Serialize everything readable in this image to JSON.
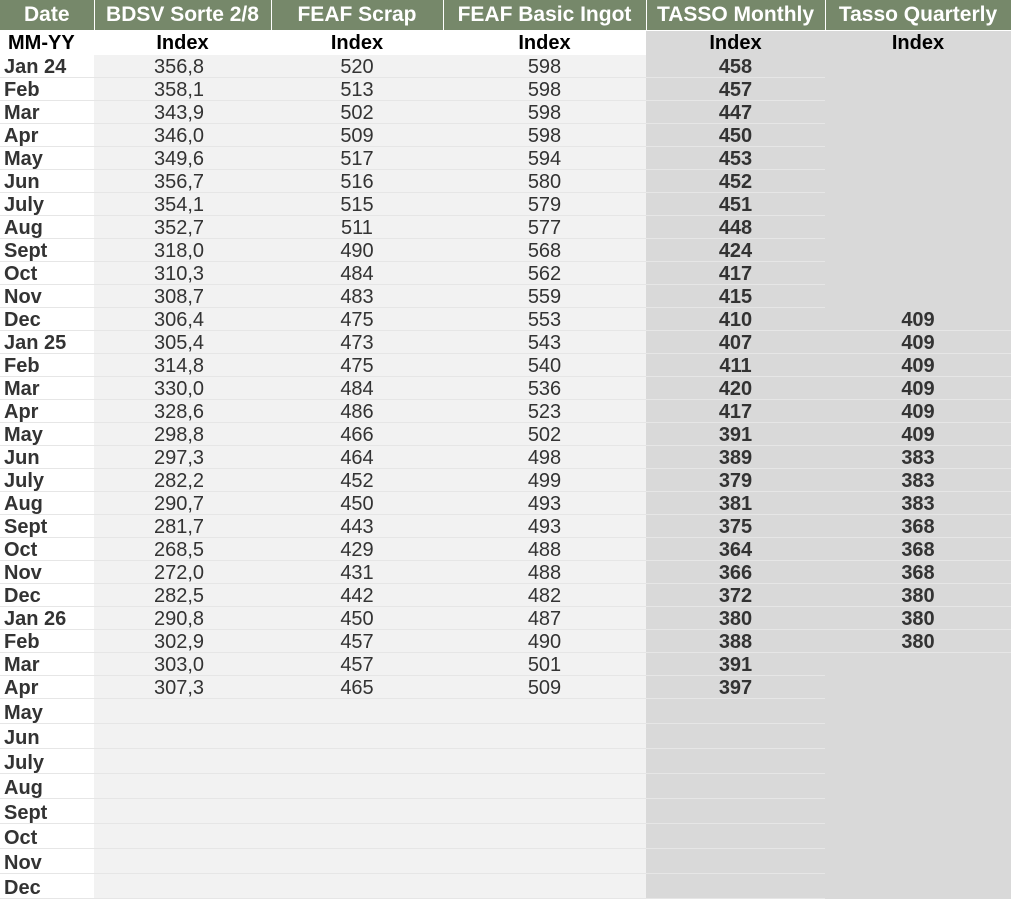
{
  "headers": {
    "date": "Date",
    "bdsv": "BDSV Sorte 2/8",
    "scrap": "FEAF Scrap",
    "ingot": "FEAF Basic Ingot",
    "monthly": "TASSO Monthly",
    "quarterly": "Tasso Quarterly"
  },
  "subheaders": {
    "date": "MM-YY",
    "bdsv": "Index",
    "scrap": "Index",
    "ingot": "Index",
    "monthly": "Index",
    "quarterly": "Index"
  },
  "rows": [
    {
      "date": "Jan 24",
      "bdsv": "356,8",
      "scrap": "520",
      "ingot": "598",
      "monthly": "458",
      "quarterly": ""
    },
    {
      "date": "Feb",
      "bdsv": "358,1",
      "scrap": "513",
      "ingot": "598",
      "monthly": "457",
      "quarterly": ""
    },
    {
      "date": "Mar",
      "bdsv": "343,9",
      "scrap": "502",
      "ingot": "598",
      "monthly": "447",
      "quarterly": ""
    },
    {
      "date": "Apr",
      "bdsv": "346,0",
      "scrap": "509",
      "ingot": "598",
      "monthly": "450",
      "quarterly": ""
    },
    {
      "date": "May",
      "bdsv": "349,6",
      "scrap": "517",
      "ingot": "594",
      "monthly": "453",
      "quarterly": ""
    },
    {
      "date": "Jun",
      "bdsv": "356,7",
      "scrap": "516",
      "ingot": "580",
      "monthly": "452",
      "quarterly": ""
    },
    {
      "date": "July",
      "bdsv": "354,1",
      "scrap": "515",
      "ingot": "579",
      "monthly": "451",
      "quarterly": ""
    },
    {
      "date": "Aug",
      "bdsv": "352,7",
      "scrap": "511",
      "ingot": "577",
      "monthly": "448",
      "quarterly": ""
    },
    {
      "date": "Sept",
      "bdsv": "318,0",
      "scrap": "490",
      "ingot": "568",
      "monthly": "424",
      "quarterly": ""
    },
    {
      "date": "Oct",
      "bdsv": "310,3",
      "scrap": "484",
      "ingot": "562",
      "monthly": "417",
      "quarterly": ""
    },
    {
      "date": "Nov",
      "bdsv": "308,7",
      "scrap": "483",
      "ingot": "559",
      "monthly": "415",
      "quarterly": ""
    },
    {
      "date": "Dec",
      "bdsv": "306,4",
      "scrap": "475",
      "ingot": "553",
      "monthly": "410",
      "quarterly": "409"
    },
    {
      "date": "Jan 25",
      "bdsv": "305,4",
      "scrap": "473",
      "ingot": "543",
      "monthly": "407",
      "quarterly": "409"
    },
    {
      "date": "Feb",
      "bdsv": "314,8",
      "scrap": "475",
      "ingot": "540",
      "monthly": "411",
      "quarterly": "409"
    },
    {
      "date": "Mar",
      "bdsv": "330,0",
      "scrap": "484",
      "ingot": "536",
      "monthly": "420",
      "quarterly": "409"
    },
    {
      "date": "Apr",
      "bdsv": "328,6",
      "scrap": "486",
      "ingot": "523",
      "monthly": "417",
      "quarterly": "409"
    },
    {
      "date": "May",
      "bdsv": "298,8",
      "scrap": "466",
      "ingot": "502",
      "monthly": "391",
      "quarterly": "409"
    },
    {
      "date": "Jun",
      "bdsv": "297,3",
      "scrap": "464",
      "ingot": "498",
      "monthly": "389",
      "quarterly": "383"
    },
    {
      "date": "July",
      "bdsv": "282,2",
      "scrap": "452",
      "ingot": "499",
      "monthly": "379",
      "quarterly": "383"
    },
    {
      "date": "Aug",
      "bdsv": "290,7",
      "scrap": "450",
      "ingot": "493",
      "monthly": "381",
      "quarterly": "383"
    },
    {
      "date": "Sept",
      "bdsv": "281,7",
      "scrap": "443",
      "ingot": "493",
      "monthly": "375",
      "quarterly": "368"
    },
    {
      "date": "Oct",
      "bdsv": "268,5",
      "scrap": "429",
      "ingot": "488",
      "monthly": "364",
      "quarterly": "368"
    },
    {
      "date": "Nov",
      "bdsv": "272,0",
      "scrap": "431",
      "ingot": "488",
      "monthly": "366",
      "quarterly": "368"
    },
    {
      "date": "Dec",
      "bdsv": "282,5",
      "scrap": "442",
      "ingot": "482",
      "monthly": "372",
      "quarterly": "380"
    },
    {
      "date": "Jan 26",
      "bdsv": "290,8",
      "scrap": "450",
      "ingot": "487",
      "monthly": "380",
      "quarterly": "380"
    },
    {
      "date": "Feb",
      "bdsv": "302,9",
      "scrap": "457",
      "ingot": "490",
      "monthly": "388",
      "quarterly": "380"
    },
    {
      "date": "Mar",
      "bdsv": "303,0",
      "scrap": "457",
      "ingot": "501",
      "monthly": "391",
      "quarterly": ""
    },
    {
      "date": "Apr",
      "bdsv": "307,3",
      "scrap": "465",
      "ingot": "509",
      "monthly": "397",
      "quarterly": ""
    },
    {
      "date": "May",
      "bdsv": "",
      "scrap": "",
      "ingot": "",
      "monthly": "",
      "quarterly": ""
    },
    {
      "date": "Jun",
      "bdsv": "",
      "scrap": "",
      "ingot": "",
      "monthly": "",
      "quarterly": ""
    },
    {
      "date": "July",
      "bdsv": "",
      "scrap": "",
      "ingot": "",
      "monthly": "",
      "quarterly": ""
    },
    {
      "date": "Aug",
      "bdsv": "",
      "scrap": "",
      "ingot": "",
      "monthly": "",
      "quarterly": ""
    },
    {
      "date": "Sept",
      "bdsv": "",
      "scrap": "",
      "ingot": "",
      "monthly": "",
      "quarterly": ""
    },
    {
      "date": "Oct",
      "bdsv": "",
      "scrap": "",
      "ingot": "",
      "monthly": "",
      "quarterly": ""
    },
    {
      "date": "Nov",
      "bdsv": "",
      "scrap": "",
      "ingot": "",
      "monthly": "",
      "quarterly": ""
    },
    {
      "date": "Dec",
      "bdsv": "",
      "scrap": "",
      "ingot": "",
      "monthly": "",
      "quarterly": ""
    }
  ],
  "colors": {
    "header_bg": "#76886a",
    "header_text": "#ffffff",
    "light_cell": "#f2f2f2",
    "gray_cell": "#d9d9d9"
  }
}
